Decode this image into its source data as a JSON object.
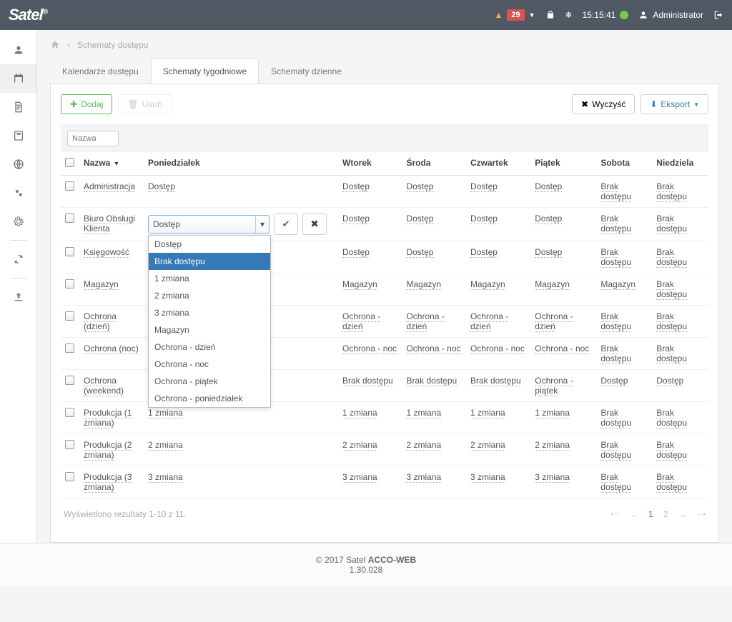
{
  "topbar": {
    "logo": "Satel",
    "notifications": "29",
    "time": "15:15:41",
    "user": "Administrator"
  },
  "breadcrumb": {
    "page": "Schematy dostępu"
  },
  "tabs": {
    "t1": "Kalendarze dostępu",
    "t2": "Schematy tygodniowe",
    "t3": "Schematy dzienne"
  },
  "toolbar": {
    "add": "Dodaj",
    "delete": "Usuń",
    "clear": "Wyczyść",
    "export": "Eksport"
  },
  "filter": {
    "placeholder": "Nazwa"
  },
  "headers": {
    "name": "Nazwa",
    "mon": "Poniedziałek",
    "tue": "Wtorek",
    "wed": "Środa",
    "thu": "Czwartek",
    "fri": "Piątek",
    "sat": "Sobota",
    "sun": "Niedziela"
  },
  "dropdown": {
    "value": "Dostęp",
    "opts": {
      "o1": "Dostęp",
      "o2": "Brak dostępu",
      "o3": "1 zmiana",
      "o4": "2 zmiana",
      "o5": "3 zmiana",
      "o6": "Magazyn",
      "o7": "Ochrona - dzień",
      "o8": "Ochrona - noc",
      "o9": "Ochrona - piątek",
      "o10": "Ochrona - poniedziałek"
    }
  },
  "rows": [
    {
      "name": "Administracja",
      "mon": "Dostęp",
      "tue": "Dostęp",
      "wed": "Dostęp",
      "thu": "Dostęp",
      "fri": "Dostęp",
      "sat": "Brak dostępu",
      "sun": "Brak dostępu"
    },
    {
      "name": "Biuro Obsługi Klienta",
      "mon": "",
      "tue": "Dostęp",
      "wed": "Dostęp",
      "thu": "Dostęp",
      "fri": "Dostęp",
      "sat": "Brak dostępu",
      "sun": "Brak dostępu"
    },
    {
      "name": "Księgowość",
      "mon": "",
      "tue": "Dostęp",
      "wed": "Dostęp",
      "thu": "Dostęp",
      "fri": "Dostęp",
      "sat": "Brak dostępu",
      "sun": "Brak dostępu"
    },
    {
      "name": "Magazyn",
      "mon": "",
      "tue": "Magazyn",
      "wed": "Magazyn",
      "thu": "Magazyn",
      "fri": "Magazyn",
      "sat": "Magazyn",
      "sun": "Brak dostępu"
    },
    {
      "name": "Ochrona (dzień)",
      "mon": "",
      "tue": "Ochrona - dzień",
      "wed": "Ochrona - dzień",
      "thu": "Ochrona - dzień",
      "fri": "Ochrona - dzień",
      "sat": "Brak dostępu",
      "sun": "Brak dostępu"
    },
    {
      "name": "Ochrona (noc)",
      "mon": "",
      "tue": "Ochrona - noc",
      "wed": "Ochrona - noc",
      "thu": "Ochrona - noc",
      "fri": "Ochrona - noc",
      "sat": "Brak dostępu",
      "sun": "Brak dostępu"
    },
    {
      "name": "Ochrona (weekend)",
      "mon": "",
      "tue": "Brak dostępu",
      "wed": "Brak dostępu",
      "thu": "Brak dostępu",
      "fri": "Ochrona - piątek",
      "sat": "Dostęp",
      "sun": "Dostęp"
    },
    {
      "name": "Produkcja (1 zmiana)",
      "mon": "1 zmiana",
      "tue": "1 zmiana",
      "wed": "1 zmiana",
      "thu": "1 zmiana",
      "fri": "1 zmiana",
      "sat": "Brak dostępu",
      "sun": "Brak dostępu"
    },
    {
      "name": "Produkcja (2 zmiana)",
      "mon": "2 zmiana",
      "tue": "2 zmiana",
      "wed": "2 zmiana",
      "thu": "2 zmiana",
      "fri": "2 zmiana",
      "sat": "Brak dostępu",
      "sun": "Brak dostępu"
    },
    {
      "name": "Produkcja (3 zmiana)",
      "mon": "3 zmiana",
      "tue": "3 zmiana",
      "wed": "3 zmiana",
      "thu": "3 zmiana",
      "fri": "3 zmiana",
      "sat": "Brak dostępu",
      "sun": "Brak dostępu"
    }
  ],
  "results": "Wyświetlono rezultaty 1-10 z 11.",
  "pager": {
    "p1": "1",
    "p2": "2"
  },
  "footer": {
    "copy": "© 2017 Satel ",
    "app": "ACCO-WEB",
    "ver": "1.30.028"
  }
}
